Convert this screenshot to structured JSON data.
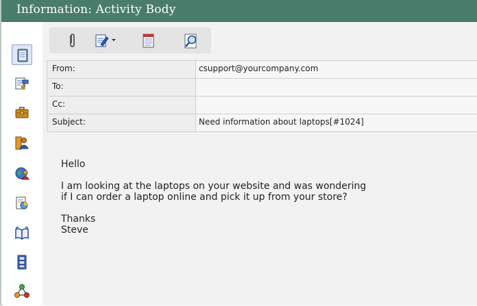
{
  "window": {
    "title": "Information: Activity Body"
  },
  "sidebar": {
    "icons": [
      {
        "name": "activity-body-icon",
        "active": true
      },
      {
        "name": "edit-note-icon"
      },
      {
        "name": "briefcase-icon"
      },
      {
        "name": "contacts-icon"
      },
      {
        "name": "globe-people-icon"
      },
      {
        "name": "report-icon"
      },
      {
        "name": "open-book-icon"
      },
      {
        "name": "cabinet-icon"
      },
      {
        "name": "network-icon"
      }
    ]
  },
  "toolbar": {
    "buttons": [
      "attachment-icon",
      "edit-icon",
      "notepad-icon",
      "magnifier-icon"
    ]
  },
  "fields": [
    {
      "label": "From:",
      "value": "csupport@yourcompany.com"
    },
    {
      "label": "To:",
      "value": ""
    },
    {
      "label": "Cc:",
      "value": ""
    },
    {
      "label": "Subject:",
      "value": "Need information about laptops[#1024]"
    }
  ],
  "message": {
    "greeting": "Hello",
    "paragraph": "I am looking at the laptops on your website and was wondering\nif I can order a laptop online and pick it up from your store?",
    "closing": "Thanks",
    "signature": "Steve"
  },
  "colors": {
    "titlebar": "#4a7c6c",
    "title_text": "#ffffff",
    "panel_bg": "#f2f2f2"
  }
}
